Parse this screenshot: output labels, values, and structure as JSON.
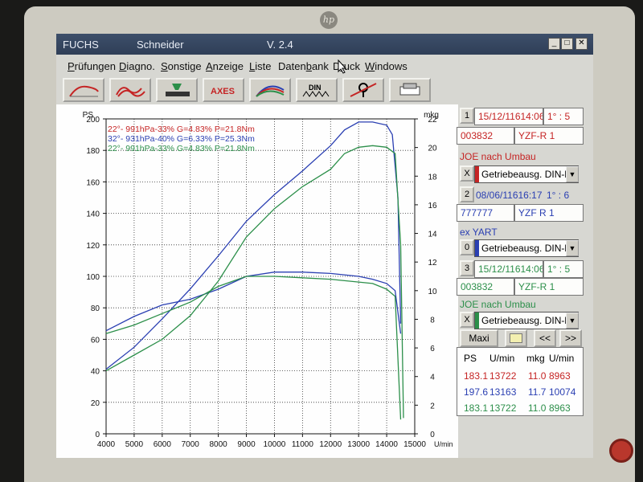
{
  "monitor": {
    "brand": "hp"
  },
  "window": {
    "app_name": "FUCHS",
    "author": "Schneider",
    "version": "V. 2.4"
  },
  "menu": [
    {
      "key": "P",
      "rest": "rüfungen"
    },
    {
      "key": "D",
      "rest": "iagno."
    },
    {
      "key": "S",
      "rest": "onstige"
    },
    {
      "key": "A",
      "rest": "nzeige"
    },
    {
      "key": "L",
      "rest": "iste"
    },
    {
      "pre": "Daten",
      "key": "b",
      "rest": "ank"
    },
    {
      "pre": "D",
      "key": "r",
      "rest": "uck"
    },
    {
      "key": "W",
      "rest": "indows"
    }
  ],
  "toolbar": {
    "axes_label": "AXES",
    "din_label": "DIN"
  },
  "runs": [
    {
      "index": "1",
      "date": "15/12/11614:06",
      "gear": "1° : 5",
      "id": "003832",
      "model": "YZF-R 1",
      "note": "JOE nach Umbau",
      "select": "X",
      "mode": "Getriebeausg. DIN-kc",
      "color": "#c52424"
    },
    {
      "index": "2",
      "date": "08/06/11616:17",
      "gear": "1° : 6",
      "id": "777777",
      "model": "YZF R 1",
      "note": "ex YART",
      "select": "0",
      "mode": "Getriebeausg. DIN-kc",
      "color": "#2a3fb2"
    },
    {
      "index": "3",
      "date": "15/12/11614:06",
      "gear": "1° : 5",
      "id": "003832",
      "model": "YZF-R 1",
      "note": "JOE nach Umbau",
      "select": "X",
      "mode": "Getriebeausg. DIN-kc",
      "color": "#2c8f4a"
    }
  ],
  "buttons": {
    "maxi": "Maxi",
    "prev": "<<",
    "next": ">>"
  },
  "results": {
    "headers": [
      "PS",
      "U/min",
      "mkg",
      "U/min"
    ],
    "rows": [
      [
        "183.1",
        "13722",
        "11.0",
        "8963"
      ],
      [
        "197.6",
        "13163",
        "11.7",
        "10074"
      ],
      [
        "183.1",
        "13722",
        "11.0",
        "8963"
      ]
    ]
  },
  "chart_data": {
    "type": "line",
    "left_axis_label": "PS",
    "right_axis_label": "mkg",
    "x_axis_unit": "U/min",
    "xlim": [
      4000,
      15000
    ],
    "ylim_left": [
      0,
      200
    ],
    "ylim_right": [
      0,
      22
    ],
    "x_ticks": [
      4000,
      5000,
      6000,
      7000,
      8000,
      9000,
      10000,
      11000,
      12000,
      13000,
      14000,
      15000
    ],
    "y_ticks_left": [
      0,
      20,
      40,
      60,
      80,
      100,
      120,
      140,
      160,
      180,
      200
    ],
    "y_ticks_right": [
      0,
      2,
      4,
      6,
      8,
      10,
      12,
      14,
      16,
      18,
      20,
      22
    ],
    "grid": true,
    "legend_position": "top-left",
    "legend": [
      {
        "text": "22°- 991hPa-33% G=4.83% P=21.8Nm",
        "color": "#c52424"
      },
      {
        "text": "32°- 931hPa-40% G=6.33% P=25.3Nm",
        "color": "#2a3fb2"
      },
      {
        "text": "22°- 991hPa-33% G=4.83% P=21.8Nm",
        "color": "#2c8f4a"
      }
    ],
    "series": [
      {
        "color": "#2a3fb2",
        "axis": "left",
        "x": [
          4000,
          5000,
          6000,
          7000,
          8000,
          9000,
          10000,
          11000,
          12000,
          12500,
          13000,
          13500,
          14000,
          14200,
          14400,
          14500
        ],
        "values": [
          41,
          55,
          73,
          92,
          113,
          135,
          152,
          167,
          183,
          193,
          198,
          198,
          196,
          190,
          150,
          70
        ]
      },
      {
        "color": "#2a3fb2",
        "axis": "right",
        "x": [
          4000,
          5000,
          6000,
          7000,
          8000,
          9000,
          10000,
          11000,
          12000,
          13000,
          13500,
          14000,
          14300,
          14500
        ],
        "values": [
          7.2,
          8.2,
          9.0,
          9.4,
          10.1,
          11.0,
          11.3,
          11.3,
          11.2,
          11.0,
          10.8,
          10.5,
          10.0,
          7.0
        ]
      },
      {
        "color": "#2c8f4a",
        "axis": "left",
        "x": [
          4000,
          5000,
          6000,
          7000,
          8000,
          9000,
          10000,
          11000,
          12000,
          12500,
          13000,
          13500,
          14000,
          14300,
          14500,
          14600
        ],
        "values": [
          40,
          50,
          60,
          75,
          97,
          125,
          143,
          157,
          168,
          178,
          182,
          183,
          182,
          178,
          120,
          10
        ]
      },
      {
        "color": "#2c8f4a",
        "axis": "right",
        "x": [
          4000,
          5000,
          6000,
          7000,
          8000,
          9000,
          10000,
          11000,
          12000,
          13000,
          13500,
          14000,
          14300,
          14500
        ],
        "values": [
          7.0,
          7.6,
          8.4,
          9.2,
          10.3,
          11.0,
          11.0,
          10.9,
          10.8,
          10.6,
          10.5,
          10.1,
          9.6,
          1.0
        ]
      }
    ]
  }
}
